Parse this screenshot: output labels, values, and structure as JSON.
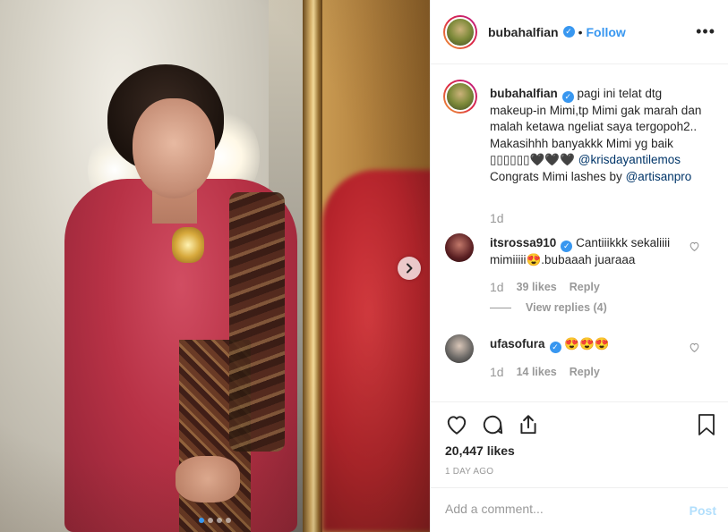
{
  "post": {
    "username": "bubahalfian",
    "follow_label": "Follow",
    "separator": "•",
    "more_label": "•••",
    "photo_alt": "Woman in red kebaya in front of a mirror",
    "carousel": {
      "count": 4,
      "active_index": 0
    }
  },
  "caption": {
    "username": "bubahalfian",
    "text_1": " pagi ini telat dtg makeup-in Mimi,tp Mimi gak marah dan malah ketawa ngeliat saya tergopoh2.. Makasihhh banyakkk Mimi yg baik ▯▯▯▯▯▯🖤🖤🖤 ",
    "mention_1": "@krisdayantilemos",
    "text_2": " Congrats Mimi lashes by ",
    "mention_2": "@artisanpro",
    "time": "1d"
  },
  "comments": [
    {
      "username": "itsrossa910",
      "verified": true,
      "text": " Cantiiikkk sekaliiii mimiiiii😍.bubaaah juaraaa",
      "time": "1d",
      "likes": "39 likes",
      "reply_label": "Reply",
      "view_replies": "View replies (4)"
    },
    {
      "username": "ufasofura",
      "verified": true,
      "text": " 😍😍😍",
      "time": "1d",
      "likes": "14 likes",
      "reply_label": "Reply"
    }
  ],
  "actions": {
    "likes": "20,447 likes",
    "posted": "1 DAY AGO"
  },
  "comment_box": {
    "placeholder": "Add a comment...",
    "post_label": "Post"
  },
  "icons": {
    "verified": "verified-badge-icon",
    "next": "chevron-right-icon",
    "like": "heart-icon",
    "comment": "speech-bubble-icon",
    "share": "share-icon",
    "save": "bookmark-icon"
  },
  "colors": {
    "link": "#3897f0",
    "mention": "#003569",
    "muted": "#999999",
    "post_disabled": "#b2dffc"
  }
}
